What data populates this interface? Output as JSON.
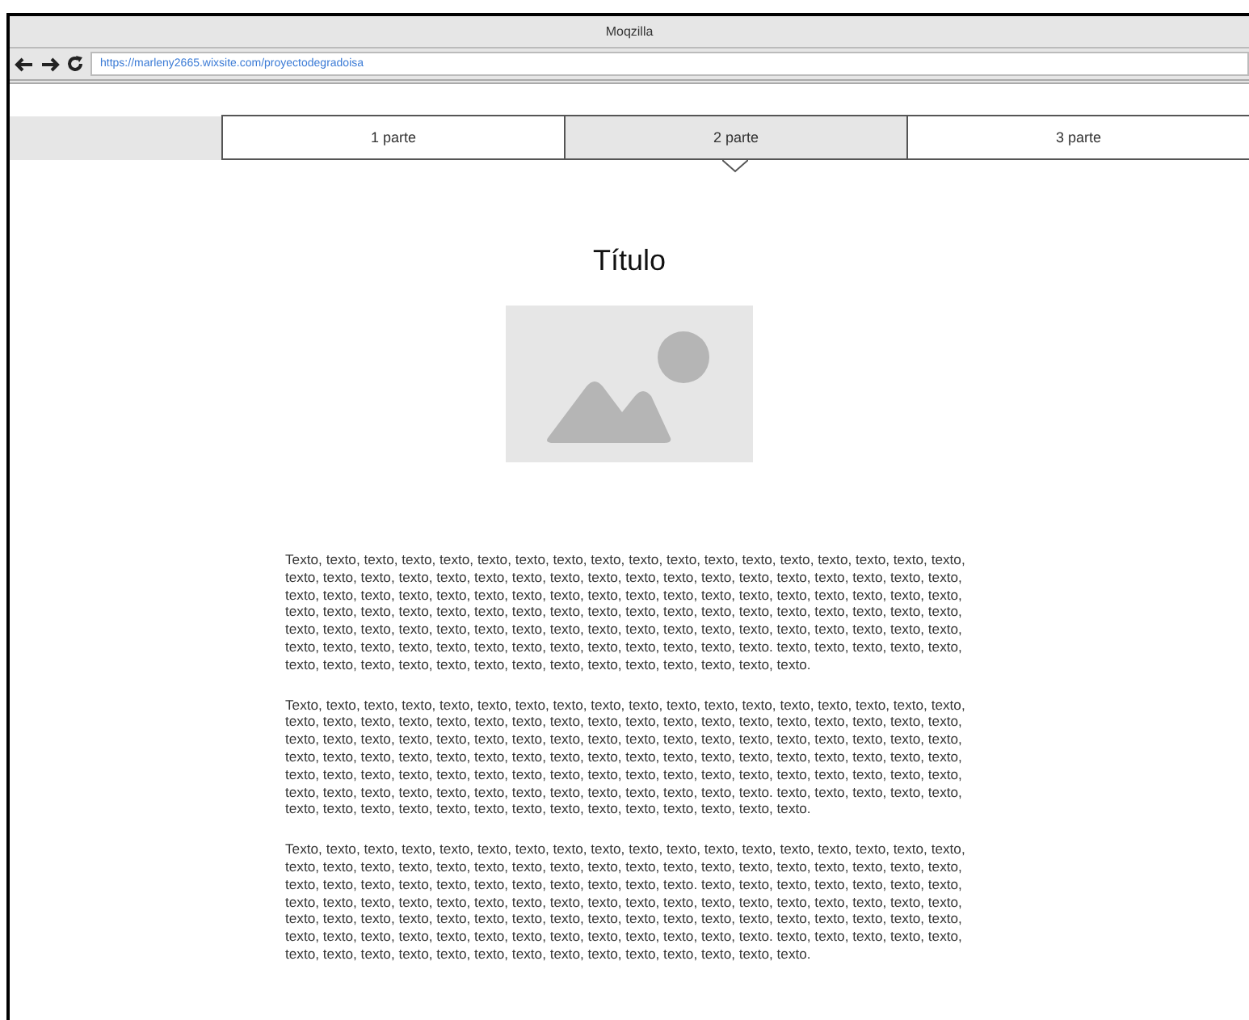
{
  "window": {
    "title": "Moqzilla"
  },
  "address_bar": {
    "url": "https://marleny2665.wixsite.com/proyectodegradoisa"
  },
  "tabs": [
    {
      "label": "1 parte",
      "selected": false
    },
    {
      "label": "2 parte",
      "selected": true
    },
    {
      "label": "3 parte",
      "selected": false
    }
  ],
  "title": "Título",
  "paragraphs": [
    "Texto, texto, texto, texto, texto, texto, texto, texto, texto, texto, texto, texto, texto, texto, texto, texto, texto, texto, texto, texto, texto, texto, texto, texto, texto, texto, texto, texto, texto, texto, texto, texto, texto, texto, texto, texto, texto, texto, texto, texto, texto, texto, texto, texto, texto, texto, texto, texto, texto, texto, texto, texto, texto, texto, texto, texto, texto, texto, texto, texto, texto, texto, texto, texto, texto, texto, texto, texto, texto, texto, texto, texto, texto, texto, texto, texto, texto, texto, texto, texto, texto, texto, texto, texto, texto, texto, texto, texto, texto, texto, texto, texto, texto, texto, texto, texto, texto, texto, texto, texto, texto, texto, texto. texto, texto, texto, texto, texto, texto, texto, texto, texto, texto, texto, texto, texto, texto, texto, texto, texto, texto, texto.",
    "Texto, texto, texto, texto, texto, texto, texto, texto, texto, texto, texto, texto, texto, texto, texto, texto, texto, texto, texto, texto, texto, texto, texto, texto, texto, texto, texto, texto, texto, texto, texto, texto, texto, texto, texto, texto, texto, texto, texto, texto, texto, texto, texto, texto, texto, texto, texto, texto, texto, texto, texto, texto, texto, texto, texto, texto, texto, texto, texto, texto, texto, texto, texto, texto, texto, texto, texto, texto, texto, texto, texto, texto, texto, texto, texto, texto, texto, texto, texto, texto, texto, texto, texto, texto, texto, texto, texto, texto, texto, texto, texto, texto, texto, texto, texto, texto, texto, texto, texto, texto, texto, texto, texto. texto, texto, texto, texto, texto, texto, texto, texto, texto, texto, texto, texto, texto, texto, texto, texto, texto, texto, texto.",
    "Texto, texto, texto, texto, texto, texto, texto, texto, texto, texto, texto, texto, texto, texto, texto, texto, texto, texto, texto, texto, texto, texto, texto, texto, texto, texto, texto, texto, texto, texto, texto, texto, texto, texto, texto, texto, texto, texto, texto, texto, texto, texto, texto, texto, texto, texto, texto. texto, texto, texto, texto, texto, texto, texto, texto, texto, texto, texto, texto, texto, texto, texto, texto, texto, texto, texto, texto, texto, texto, texto, texto, texto, texto, texto, texto, texto, texto, texto, texto, texto, texto, texto, texto, texto, texto, texto, texto, texto, texto, texto, texto, texto, texto, texto, texto, texto, texto, texto, texto, texto, texto, texto, texto. texto, texto, texto, texto, texto, texto, texto, texto, texto, texto, texto, texto, texto, texto, texto, texto, texto, texto, texto."
  ]
}
